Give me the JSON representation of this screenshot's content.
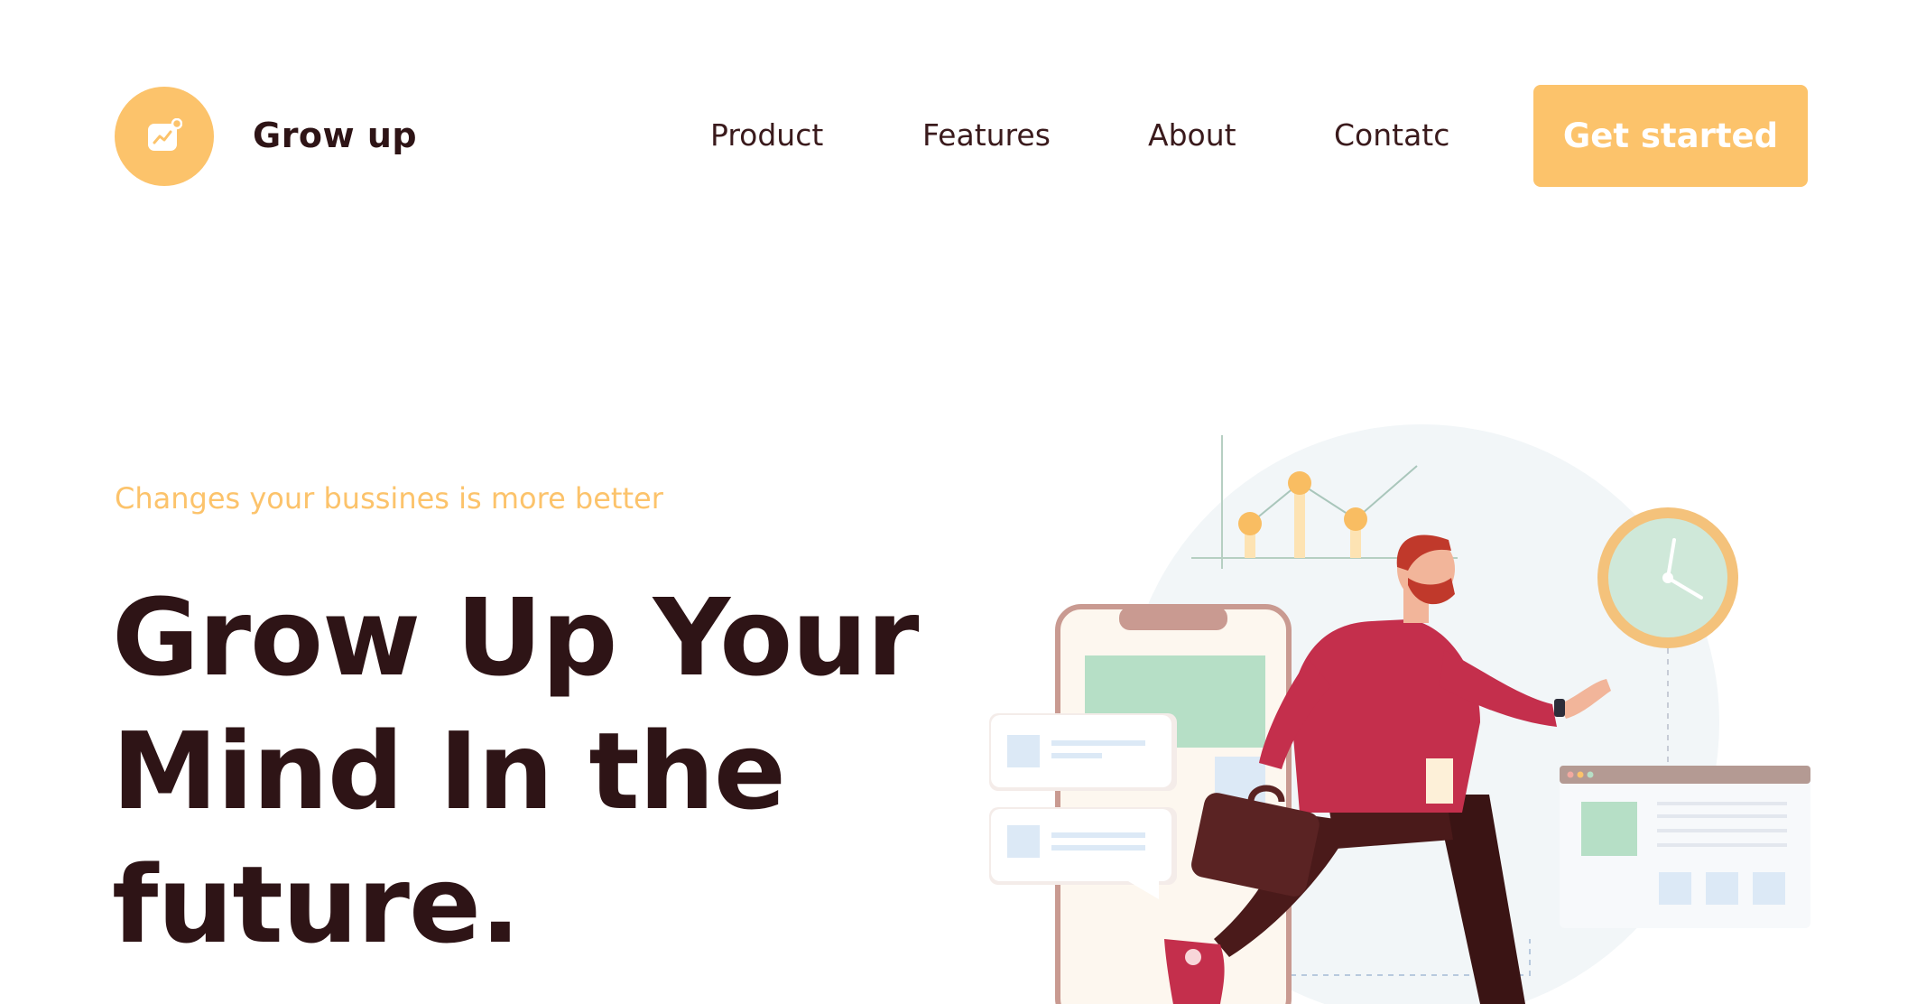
{
  "header": {
    "brand_name": "Grow up",
    "logo_icon": "chart-app-icon",
    "nav": [
      "Product",
      "Features",
      "About",
      "Contatc"
    ],
    "cta_label": "Get started"
  },
  "hero": {
    "tagline": "Changes your bussines is more better",
    "headline_lines": [
      "Grow Up Your",
      "Mind In the",
      "future."
    ]
  },
  "colors": {
    "accent": "#fcc36b",
    "text_dark": "#2e1416",
    "figure_red": "#c42f4c",
    "figure_pants": "#4a1a1a",
    "chart_green": "#b6dfc6",
    "clock_ring": "#f4c27b"
  }
}
